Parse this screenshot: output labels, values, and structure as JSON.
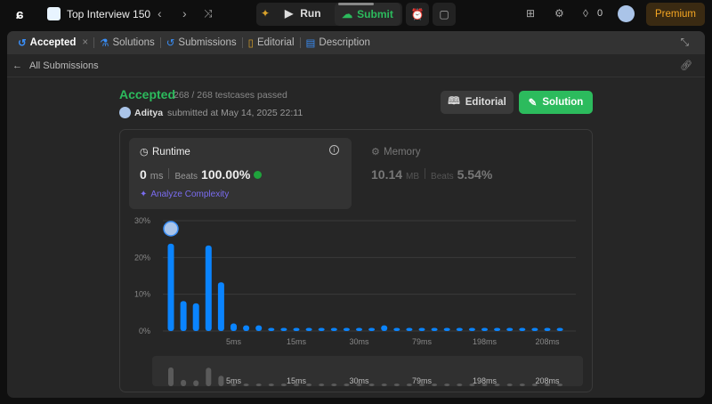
{
  "topbar": {
    "problem_list": "Top Interview 150",
    "run": "Run",
    "submit": "Submit",
    "streak": "0",
    "premium": "Premium"
  },
  "tabs": [
    {
      "label": "Accepted"
    },
    {
      "label": "Solutions"
    },
    {
      "label": "Submissions"
    },
    {
      "label": "Editorial"
    },
    {
      "label": "Description"
    }
  ],
  "back_label": "All Submissions",
  "result": {
    "status": "Accepted",
    "testcases": "268 / 268 testcases passed",
    "user": "Aditya",
    "submitted": "submitted at May 14, 2025 22:11",
    "editorial_btn": "Editorial",
    "solution_btn": "Solution"
  },
  "runtime": {
    "title": "Runtime",
    "value": "0",
    "unit": "ms",
    "beats_label": "Beats",
    "beats": "100.00%",
    "analyze": "Analyze Complexity"
  },
  "memory": {
    "title": "Memory",
    "value": "10.14",
    "unit": "MB",
    "beats_label": "Beats",
    "beats": "5.54%"
  },
  "colors": {
    "accent": "#2cbb5d",
    "bar": "#0a84ff"
  },
  "chart_data": {
    "type": "bar",
    "ylabel": "",
    "xlabel": "",
    "ylim": [
      0,
      30
    ],
    "yticks": [
      "0%",
      "10%",
      "20%",
      "30%"
    ],
    "values": [
      23.5,
      7.9,
      7.3,
      23,
      13,
      1.8,
      1.3,
      1.3,
      0.6,
      0.6,
      0.6,
      0.6,
      0.6,
      0.6,
      0.6,
      0.6,
      0.6,
      1.3,
      0.6,
      0.6,
      0.6,
      0.6,
      0.6,
      0.6,
      0.6,
      0.6,
      0.6,
      0.6,
      0.6,
      0.6,
      0.6,
      0.6
    ],
    "xtick_labels": [
      {
        "index": 5,
        "label": "5ms"
      },
      {
        "index": 10,
        "label": "15ms"
      },
      {
        "index": 15,
        "label": "30ms"
      },
      {
        "index": 20,
        "label": "79ms"
      },
      {
        "index": 25,
        "label": "198ms"
      },
      {
        "index": 30,
        "label": "208ms"
      }
    ],
    "highlight_index": 0
  }
}
